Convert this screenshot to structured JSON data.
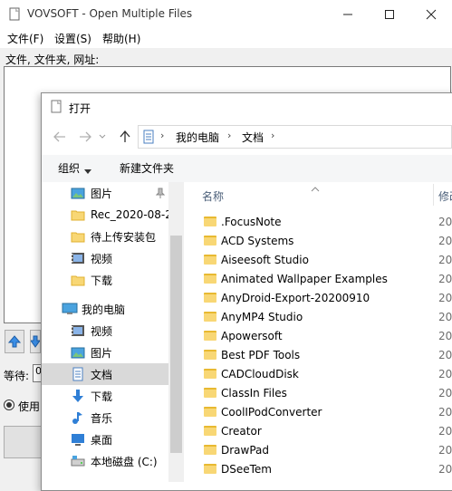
{
  "app": {
    "title": "VOVSOFT - Open Multiple Files",
    "menu": [
      "文件(F)",
      "设置(S)",
      "帮助(H)"
    ],
    "files_label": "文件, 文件夹, 网址:",
    "wait_label": "等待:",
    "wait_value": "0",
    "radio_label": "使用"
  },
  "dialog": {
    "title": "打开",
    "breadcrumb": [
      "我的电脑",
      "文档"
    ],
    "commands": {
      "organize": "组织",
      "new_folder": "新建文件夹"
    },
    "nav_items": [
      {
        "label": "图片",
        "icon": "pictures-icon",
        "pinned": true
      },
      {
        "label": "Rec_2020-08-2",
        "icon": "folder-icon"
      },
      {
        "label": "待上传安装包",
        "icon": "folder-icon"
      },
      {
        "label": "视频",
        "icon": "videos-icon"
      },
      {
        "label": "下载",
        "icon": "folder-icon"
      },
      {
        "label": "我的电脑",
        "icon": "computer-icon"
      },
      {
        "label": "视频",
        "icon": "videos-icon"
      },
      {
        "label": "图片",
        "icon": "pictures-icon"
      },
      {
        "label": "文档",
        "icon": "documents-icon",
        "selected": true
      },
      {
        "label": "下载",
        "icon": "download-icon"
      },
      {
        "label": "音乐",
        "icon": "music-icon"
      },
      {
        "label": "桌面",
        "icon": "desktop-icon"
      },
      {
        "label": "本地磁盘 (C:)",
        "icon": "drive-icon"
      }
    ],
    "columns": {
      "name": "名称",
      "date": "修改"
    },
    "files": [
      {
        "name": ".FocusNote",
        "date": "20"
      },
      {
        "name": "ACD Systems",
        "date": "20"
      },
      {
        "name": "Aiseesoft Studio",
        "date": "20"
      },
      {
        "name": "Animated Wallpaper Examples",
        "date": "20"
      },
      {
        "name": "AnyDroid-Export-20200910",
        "date": "20"
      },
      {
        "name": "AnyMP4 Studio",
        "date": "20"
      },
      {
        "name": "Apowersoft",
        "date": "20"
      },
      {
        "name": "Best PDF Tools",
        "date": "20"
      },
      {
        "name": "CADCloudDisk",
        "date": "20"
      },
      {
        "name": "ClassIn Files",
        "date": "20"
      },
      {
        "name": "CoolIPodConverter",
        "date": "20"
      },
      {
        "name": "Creator",
        "date": "20"
      },
      {
        "name": "DrawPad",
        "date": "20"
      },
      {
        "name": "DSeeTem",
        "date": "20"
      }
    ]
  }
}
